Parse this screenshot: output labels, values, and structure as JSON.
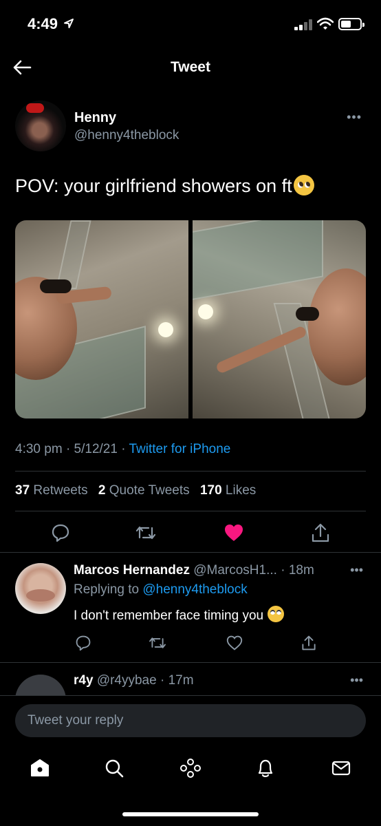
{
  "status_bar": {
    "time": "4:49"
  },
  "header": {
    "title": "Tweet"
  },
  "tweet": {
    "author_name": "Henny",
    "author_handle": "@henny4theblock",
    "text": "POV: your girlfriend showers on ft",
    "time": "4:30 pm",
    "date": "5/12/21",
    "source": "Twitter for iPhone",
    "retweets_count": "37",
    "retweets_label": "Retweets",
    "quotes_count": "2",
    "quotes_label": "Quote Tweets",
    "likes_count": "170",
    "likes_label": "Likes",
    "liked": true,
    "like_color": "#f91880",
    "link_color": "#1d9bf0"
  },
  "replies": [
    {
      "name": "Marcos Hernandez",
      "handle": "@MarcosH1...",
      "time": "18m",
      "replying_label": "Replying to",
      "replying_to": "@henny4theblock",
      "text": "I don't remember face timing you"
    },
    {
      "name": "r4y",
      "handle": "@r4yybae",
      "time": "17m"
    }
  ],
  "compose": {
    "placeholder": "Tweet your reply"
  },
  "tabs": [
    "home-icon",
    "search-icon",
    "spaces-icon",
    "notifications-icon",
    "messages-icon"
  ]
}
